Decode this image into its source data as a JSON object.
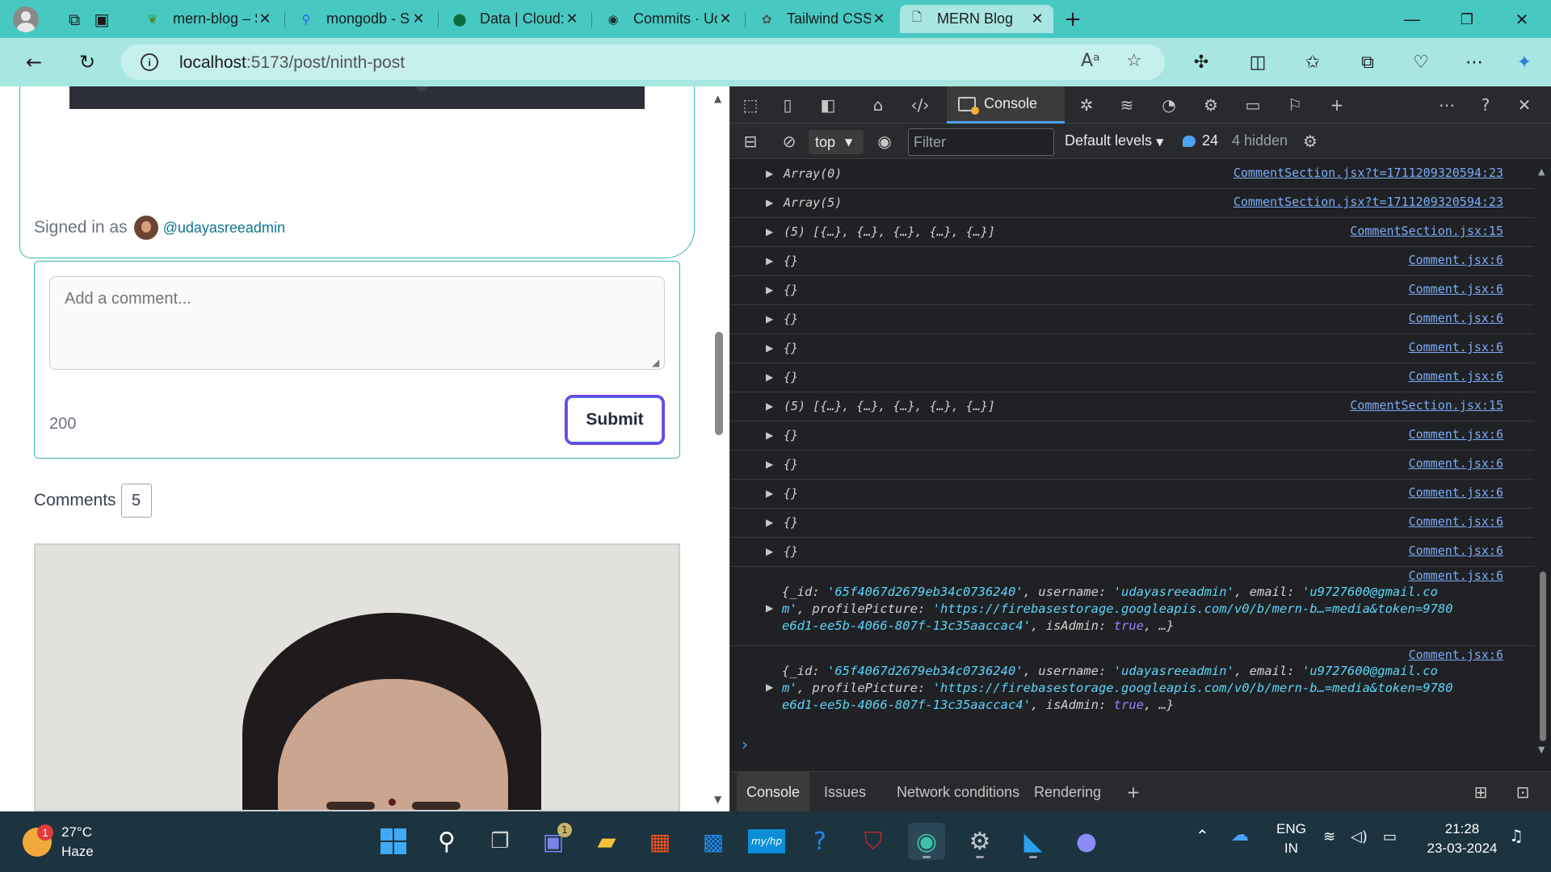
{
  "browser": {
    "tabs": [
      {
        "title": "mern-blog – Stor",
        "favicon": "leaf-icon"
      },
      {
        "title": "mongodb - Searc",
        "favicon": "search-icon"
      },
      {
        "title": "Data | Cloud: Mo",
        "favicon": "leaf-icon"
      },
      {
        "title": "Commits · Udaya",
        "favicon": "github-icon"
      },
      {
        "title": "Tailwind CSS in M",
        "favicon": "openai-icon"
      },
      {
        "title": "MERN Blog",
        "favicon": "page-icon",
        "active": true
      }
    ],
    "new_tab_label": "+",
    "url_host": "localhost",
    "url_rest": ":5173/post/ninth-post"
  },
  "page": {
    "signed_in_prefix": "Signed in as",
    "signed_in_user": "@udayasreeadmin",
    "comment_placeholder": "Add a comment...",
    "chars_remaining": "200",
    "submit_label": "Submit",
    "comments_label": "Comments",
    "comments_count": "5"
  },
  "devtools": {
    "active_tab": "Console",
    "context": "top",
    "filter_placeholder": "Filter",
    "levels": "Default levels",
    "message_count": "24",
    "hidden_count": "4 hidden",
    "logs": [
      {
        "value": "Array(0)",
        "source": "CommentSection.jsx?t=1711209320594:23"
      },
      {
        "value": "Array(5)",
        "source": "CommentSection.jsx?t=1711209320594:23"
      },
      {
        "value": "(5) [{…}, {…}, {…}, {…}, {…}]",
        "source": "CommentSection.jsx:15"
      },
      {
        "value": "{}",
        "source": "Comment.jsx:6"
      },
      {
        "value": "{}",
        "source": "Comment.jsx:6"
      },
      {
        "value": "{}",
        "source": "Comment.jsx:6"
      },
      {
        "value": "{}",
        "source": "Comment.jsx:6"
      },
      {
        "value": "{}",
        "source": "Comment.jsx:6"
      },
      {
        "value": "(5) [{…}, {…}, {…}, {…}, {…}]",
        "source": "CommentSection.jsx:15"
      },
      {
        "value": "{}",
        "source": "Comment.jsx:6"
      },
      {
        "value": "{}",
        "source": "Comment.jsx:6"
      },
      {
        "value": "{}",
        "source": "Comment.jsx:6"
      },
      {
        "value": "{}",
        "source": "Comment.jsx:6"
      },
      {
        "value": "{}",
        "source": "Comment.jsx:6"
      }
    ],
    "object_logs": [
      {
        "source": "Comment.jsx:6",
        "id": "'65f4067d2679eb34c0736240'",
        "username": "'udayasreeadmin'",
        "email_part1": "'u9727600@gmail.co",
        "email_part2": "m'",
        "profile_picture": "'https://firebasestorage.googleapis.com/v0/b/mern-b…=media&token=9780",
        "profile_picture_cont": "e6d1-ee5b-4066-807f-13c35aaccac4'",
        "is_admin": "true"
      },
      {
        "source": "Comment.jsx:6",
        "id": "'65f4067d2679eb34c0736240'",
        "username": "'udayasreeadmin'",
        "email_part1": "'u9727600@gmail.co",
        "email_part2": "m'",
        "profile_picture": "'https://firebasestorage.googleapis.com/v0/b/mern-b…=media&token=9780",
        "profile_picture_cont": "e6d1-ee5b-4066-807f-13c35aaccac4'",
        "is_admin": "true"
      }
    ],
    "drawer_tabs": [
      "Console",
      "Issues",
      "Network conditions",
      "Rendering"
    ]
  },
  "taskbar": {
    "temperature": "27°C",
    "weather": "Haze",
    "weather_badge": "1",
    "chat_badge": "1",
    "lang_1": "ENG",
    "lang_2": "IN",
    "time": "21:28",
    "date": "23-03-2024",
    "mylp_label": "my/hp"
  },
  "colors": {
    "tabstrip": "#47c9c2",
    "accent_teal": "#35b6b0",
    "submit_border": "#6d45d9",
    "devtools_bg": "#202124",
    "link": "#7cacf8",
    "string": "#5cd5fb",
    "boolean": "#9980ff"
  }
}
